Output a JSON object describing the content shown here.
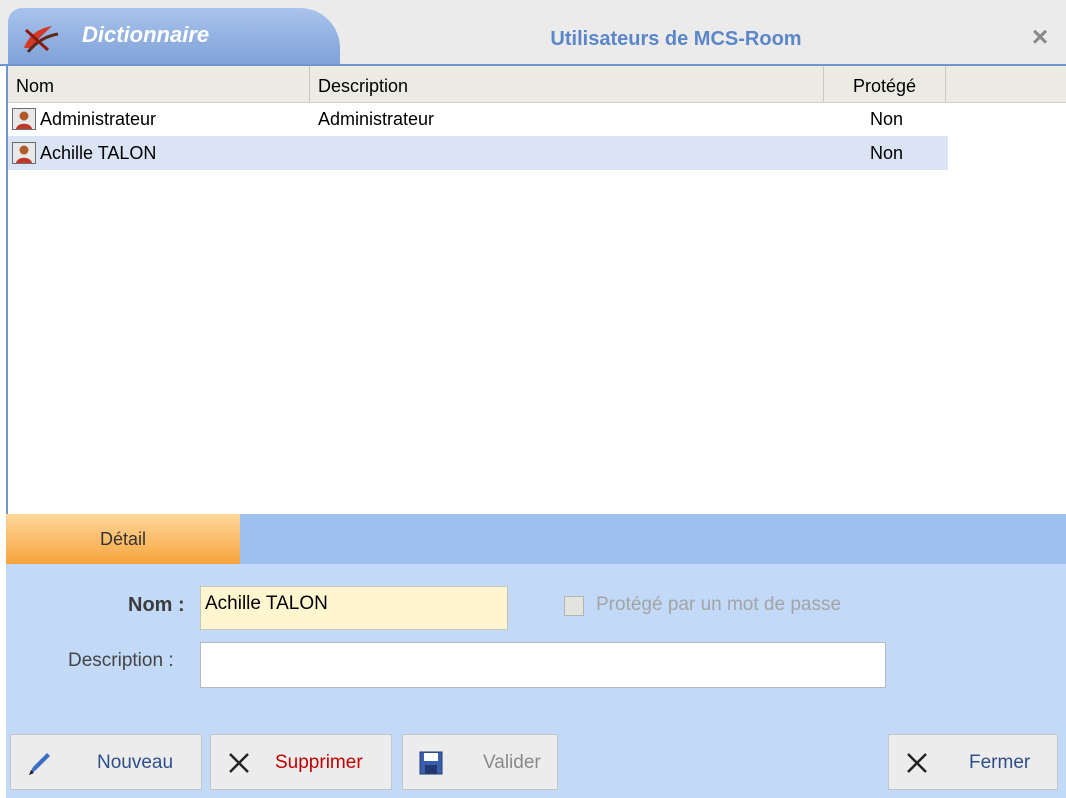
{
  "window": {
    "tab_label": "Dictionnaire",
    "title": "Utilisateurs de MCS-Room",
    "close_glyph": "×"
  },
  "list": {
    "columns": [
      "Nom",
      "Description",
      "Protégé"
    ],
    "rows": [
      {
        "nom": "Administrateur",
        "description": "Administrateur",
        "protege": "Non",
        "icon": "user-icon"
      },
      {
        "nom": "Achille TALON",
        "description": "",
        "protege": "Non",
        "icon": "user-icon",
        "selected": true
      }
    ]
  },
  "detail": {
    "tab_label": "Détail",
    "nom_label": "Nom :",
    "nom_value": "Achille TALON",
    "description_label": "Description :",
    "description_value": "",
    "protege_label": "Protégé par un mot de passe",
    "protege_checked": false
  },
  "toolbar": {
    "nouveau": "Nouveau",
    "supprimer": "Supprimer",
    "valider": "Valider",
    "fermer": "Fermer"
  },
  "colors": {
    "accent": "#5b87c9",
    "tab_orange": "#f6a43e",
    "form_bg": "#c2daf8",
    "selected_row": "#dae4f4",
    "delete_red": "#c00000"
  }
}
